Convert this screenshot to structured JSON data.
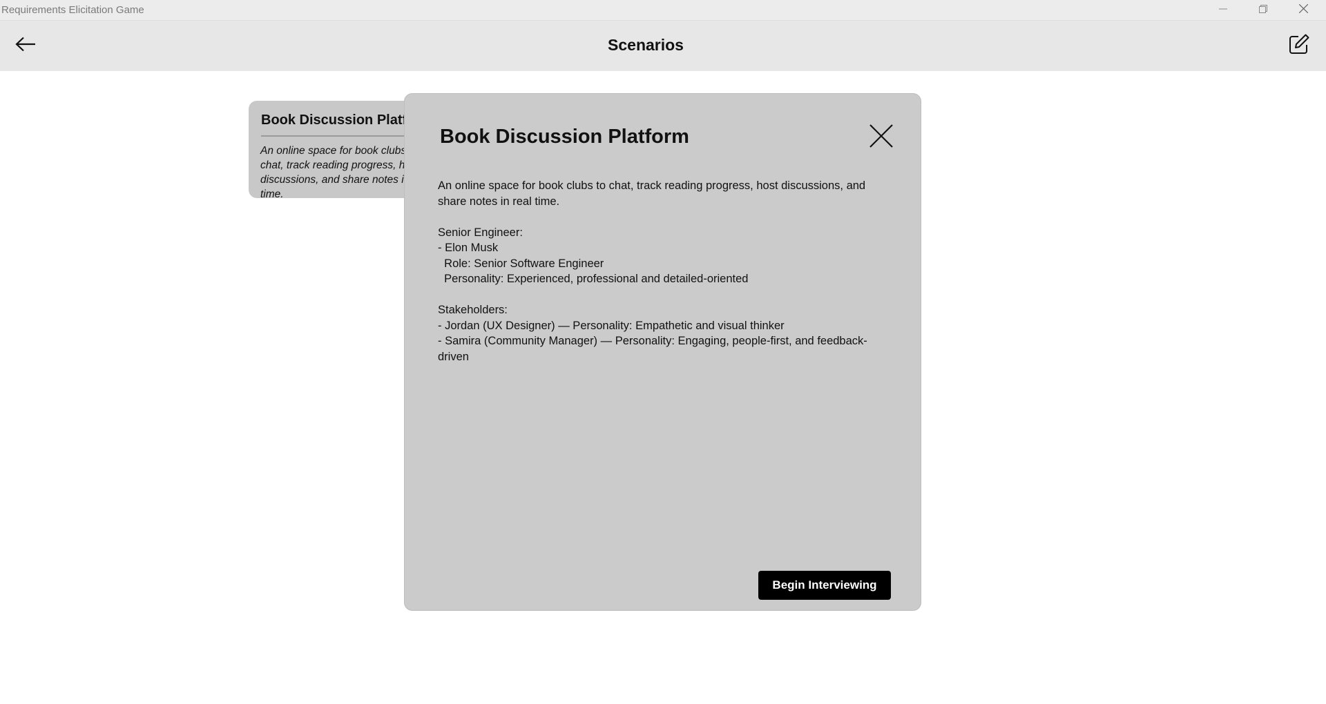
{
  "window": {
    "title": "Requirements Elicitation Game",
    "controls": {
      "minimize_icon": "minimize-icon",
      "restore_icon": "restore-icon",
      "close_icon": "close-icon"
    }
  },
  "header": {
    "title": "Scenarios",
    "back_icon": "arrow-left-icon",
    "edit_icon": "edit-icon"
  },
  "scenario_card": {
    "title": "Book Discussion Platform",
    "description": "An online space for book clubs to chat, track reading progress, host discussions, and share notes in real time."
  },
  "modal": {
    "title": "Book Discussion Platform",
    "close_icon": "close-icon",
    "description": "An online space for book clubs to chat, track reading progress, host discussions, and share notes in real time.",
    "engineer_heading": "Senior Engineer:",
    "engineer_name": "- Elon Musk",
    "engineer_role": "  Role: Senior Software Engineer",
    "engineer_personality": "  Personality: Experienced, professional and detailed-oriented",
    "stakeholders_heading": "Stakeholders:",
    "stakeholders": [
      "- Jordan (UX Designer) — Personality: Empathetic and visual thinker",
      "- Samira (Community Manager) — Personality: Engaging, people-first, and feedback-driven"
    ],
    "begin_button": "Begin Interviewing"
  },
  "colors": {
    "header_bg": "#e7e7e7",
    "titlebar_bg": "#ececec",
    "card_bg": "#c8c8c8",
    "modal_bg": "#cbcbcb",
    "button_bg": "#000000",
    "button_text": "#ffffff"
  }
}
